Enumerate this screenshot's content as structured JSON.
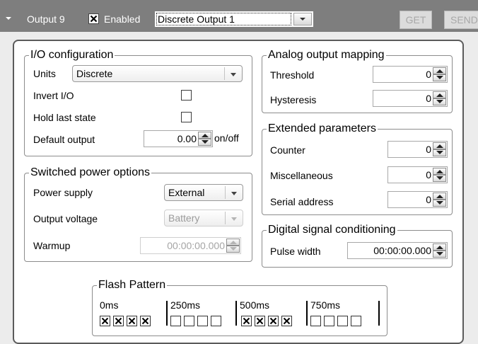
{
  "header": {
    "title": "Output 9",
    "enabled_label": "Enabled",
    "enabled_checked": true,
    "output_select": "Discrete Output 1",
    "get_label": "GET",
    "send_label": "SEND"
  },
  "io_config": {
    "legend": "I/O configuration",
    "units_label": "Units",
    "units_value": "Discrete",
    "invert_label": "Invert I/O",
    "invert_checked": false,
    "hold_label": "Hold last state",
    "hold_checked": false,
    "default_label": "Default output",
    "default_value": "0.00",
    "default_unit": "on/off"
  },
  "switched_power": {
    "legend": "Switched power options",
    "supply_label": "Power supply",
    "supply_value": "External",
    "voltage_label": "Output voltage",
    "voltage_value": "Battery",
    "warmup_label": "Warmup",
    "warmup_value": "00:00:00.000"
  },
  "analog_mapping": {
    "legend": "Analog output mapping",
    "threshold_label": "Threshold",
    "threshold_value": "0",
    "hysteresis_label": "Hysteresis",
    "hysteresis_value": "0"
  },
  "extended": {
    "legend": "Extended parameters",
    "counter_label": "Counter",
    "counter_value": "0",
    "misc_label": "Miscellaneous",
    "misc_value": "0",
    "serial_label": "Serial address",
    "serial_value": "0"
  },
  "digital_signal": {
    "legend": "Digital signal conditioning",
    "pulse_label": "Pulse width",
    "pulse_value": "00:00:00.000"
  },
  "flash_pattern": {
    "legend": "Flash Pattern",
    "time_labels": [
      "0ms",
      "250ms",
      "500ms",
      "750ms"
    ],
    "cells": [
      true,
      true,
      true,
      true,
      false,
      false,
      false,
      false,
      true,
      true,
      true,
      true,
      false,
      false,
      false,
      false
    ]
  }
}
